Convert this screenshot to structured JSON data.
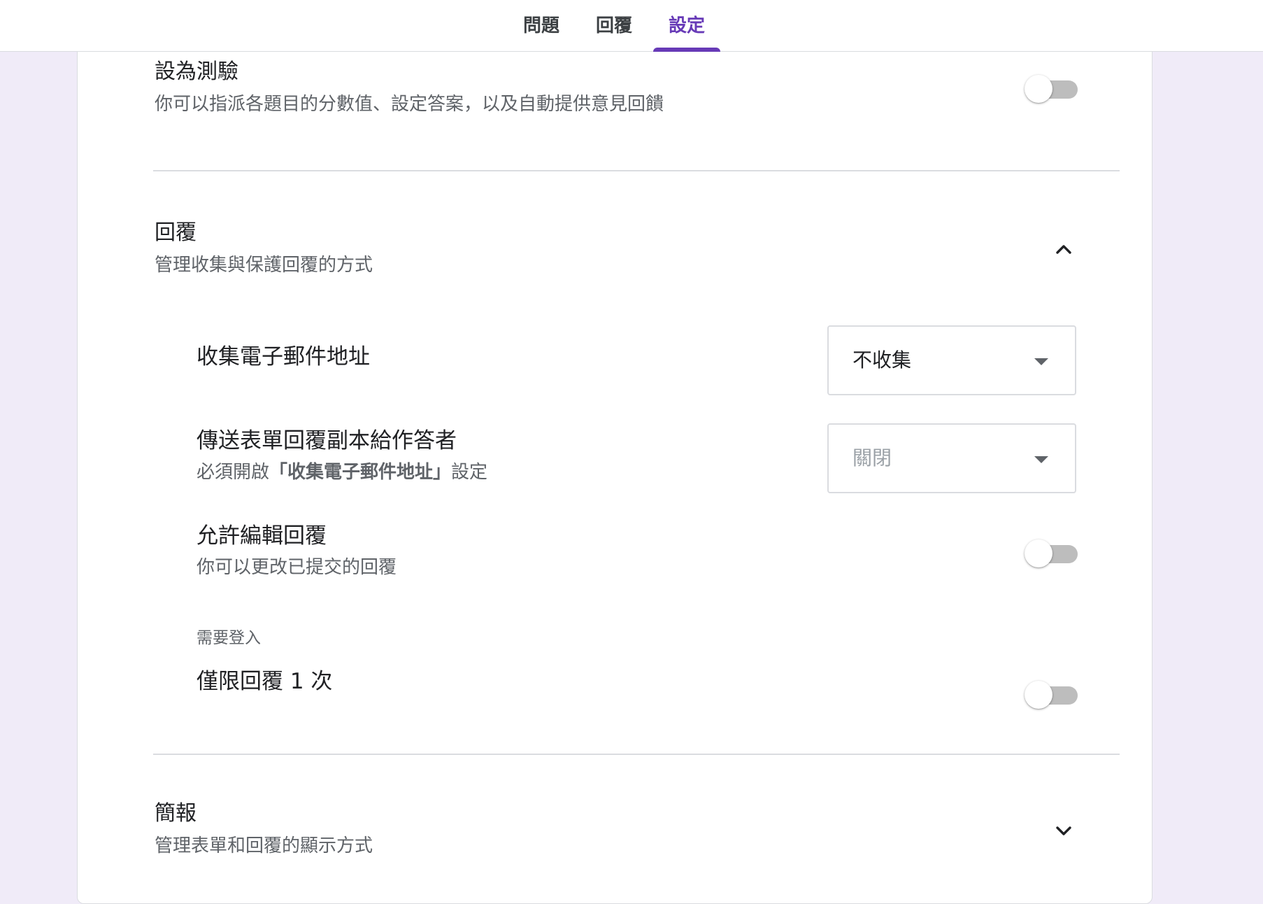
{
  "tabs": [
    {
      "label": "問題"
    },
    {
      "label": "回覆"
    },
    {
      "label": "設定",
      "active": true
    }
  ],
  "accent_color": "#673ab7",
  "quiz": {
    "title": "設為測驗",
    "description": "你可以指派各題目的分數值、設定答案，以及自動提供意見回饋",
    "enabled": false
  },
  "responses": {
    "title": "回覆",
    "description": "管理收集與保護回覆的方式",
    "expanded": true,
    "expand_icon": "chevron-up-icon",
    "collect_email": {
      "label": "收集電子郵件地址",
      "value": "不收集"
    },
    "send_copy": {
      "label": "傳送表單回覆副本給作答者",
      "note_prefix": "必須開啟",
      "note_bold": "「收集電子郵件地址」",
      "note_suffix": "設定",
      "value": "關閉",
      "disabled": true
    },
    "allow_edit": {
      "label": "允許編輯回覆",
      "description": "你可以更改已提交的回覆",
      "enabled": false
    },
    "requires_signin": {
      "heading": "需要登入",
      "limit_one": {
        "label": "僅限回覆 1 次",
        "enabled": false
      }
    }
  },
  "presentation": {
    "title": "簡報",
    "description": "管理表單和回覆的顯示方式",
    "expanded": false,
    "expand_icon": "chevron-down-icon"
  }
}
